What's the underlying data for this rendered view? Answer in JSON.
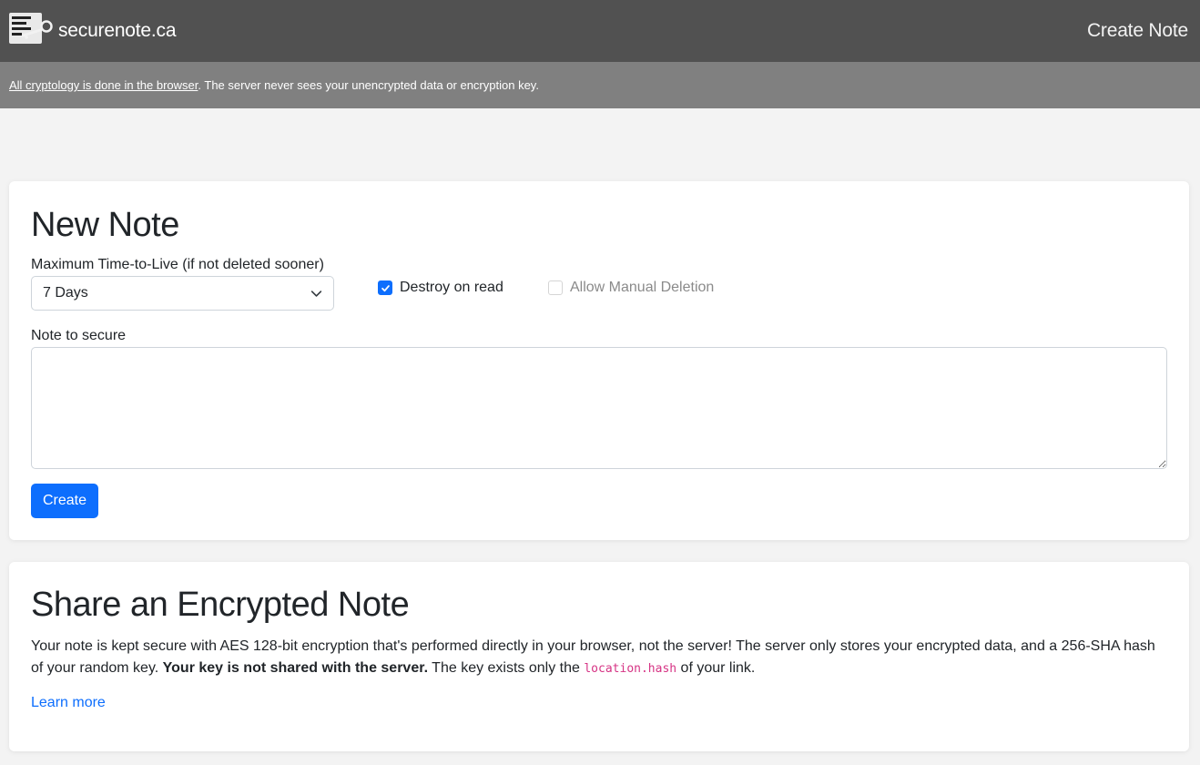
{
  "header": {
    "brand": "securenote.ca",
    "nav_link": "Create Note"
  },
  "notice": {
    "link_text": "All cryptology is done in the browser",
    "rest_text": ". The server never sees your unencrypted data or encryption key."
  },
  "new_note": {
    "title": "New Note",
    "ttl_label": "Maximum Time-to-Live (if not deleted sooner)",
    "ttl_value": "7 Days",
    "destroy_on_read": {
      "label": "Destroy on read",
      "checked": true
    },
    "allow_manual_deletion": {
      "label": "Allow Manual Deletion",
      "checked": false,
      "disabled": true
    },
    "note_label": "Note to secure",
    "note_value": "",
    "create_button": "Create"
  },
  "share": {
    "title": "Share an Encrypted Note",
    "text_1": "Your note is kept secure with AES 128-bit encryption that's performed directly in your browser, not the server! The server only stores your encrypted data, and a 256-SHA hash of your random key. ",
    "text_bold": "Your key is not shared with the server.",
    "text_2": " The key exists only the ",
    "code": "location.hash",
    "text_3": " of your link.",
    "learn_more": "Learn more"
  },
  "colors": {
    "header_bg": "#515151",
    "notice_bg": "#808080",
    "accent": "#0d6efd",
    "code": "#d63384"
  },
  "icons": {
    "brand": "note-key-logo-icon",
    "select": "chevron-down-icon",
    "check": "checkmark-icon"
  }
}
